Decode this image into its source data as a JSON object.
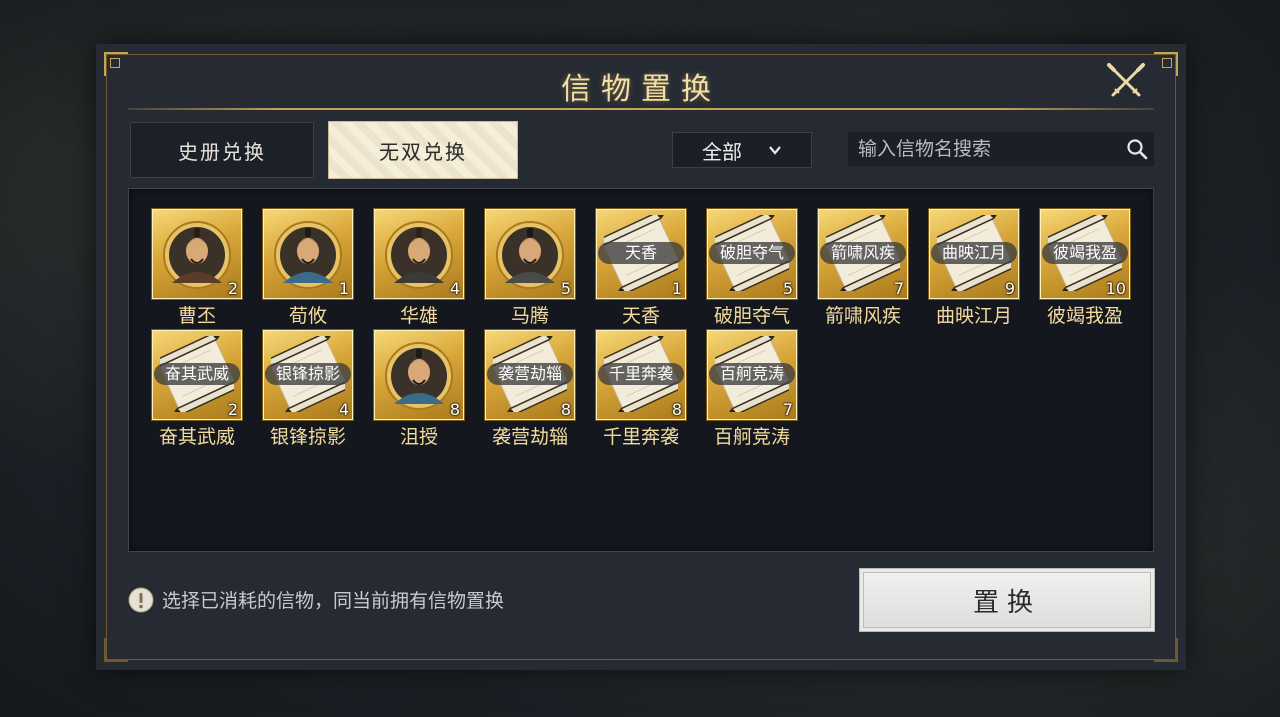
{
  "dialog": {
    "title": "信物置换"
  },
  "tabs": [
    {
      "label": "史册兑换",
      "active": false
    },
    {
      "label": "无双兑换",
      "active": true
    }
  ],
  "filter": {
    "selected": "全部"
  },
  "search": {
    "placeholder": "输入信物名搜索",
    "value": ""
  },
  "items": [
    {
      "name": "曹丕",
      "count": "2",
      "kind": "portrait",
      "label": ""
    },
    {
      "name": "荀攸",
      "count": "1",
      "kind": "portrait",
      "label": ""
    },
    {
      "name": "华雄",
      "count": "4",
      "kind": "portrait",
      "label": ""
    },
    {
      "name": "马腾",
      "count": "5",
      "kind": "portrait",
      "label": ""
    },
    {
      "name": "天香",
      "count": "1",
      "kind": "scroll",
      "label": "天香"
    },
    {
      "name": "破胆夺气",
      "count": "5",
      "kind": "scroll",
      "label": "破胆夺气"
    },
    {
      "name": "箭啸风疾",
      "count": "7",
      "kind": "scroll",
      "label": "箭啸风疾"
    },
    {
      "name": "曲映江月",
      "count": "9",
      "kind": "scroll",
      "label": "曲映江月"
    },
    {
      "name": "彼竭我盈",
      "count": "10",
      "kind": "scroll",
      "label": "彼竭我盈"
    },
    {
      "name": "奋其武威",
      "count": "2",
      "kind": "scroll",
      "label": "奋其武威"
    },
    {
      "name": "银锋掠影",
      "count": "4",
      "kind": "scroll",
      "label": "银锋掠影"
    },
    {
      "name": "沮授",
      "count": "8",
      "kind": "portrait",
      "label": ""
    },
    {
      "name": "袭营劫辎",
      "count": "8",
      "kind": "scroll",
      "label": "袭营劫辎"
    },
    {
      "name": "千里奔袭",
      "count": "8",
      "kind": "scroll",
      "label": "千里奔袭"
    },
    {
      "name": "百舸竞涛",
      "count": "7",
      "kind": "scroll",
      "label": "百舸竞涛"
    }
  ],
  "hint": {
    "text": "选择已消耗的信物，同当前拥有信物置换",
    "icon": "exclamation-icon"
  },
  "confirm": {
    "label": "置换"
  },
  "colors": {
    "accent_gold": "#c8a457",
    "item_name": "#f3dba0",
    "title": "#f3dfa6"
  }
}
